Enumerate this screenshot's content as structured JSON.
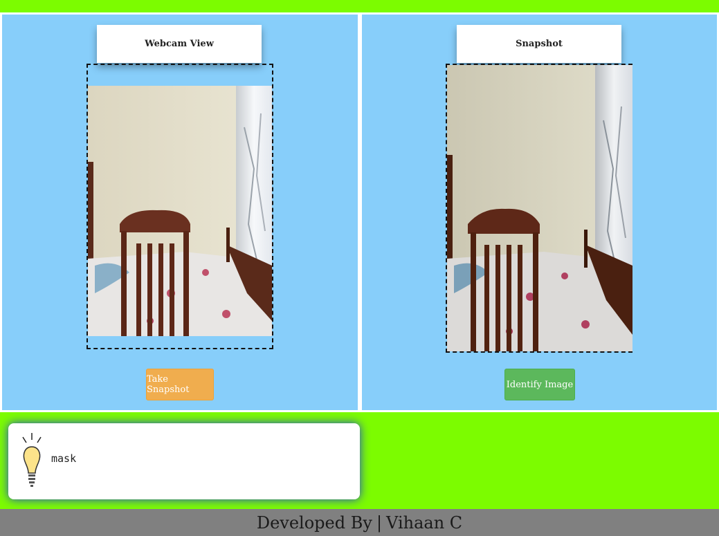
{
  "webcam": {
    "title": "Webcam View",
    "button_label": "Take Snapshot"
  },
  "snapshot": {
    "title": "Snapshot",
    "button_label": "Identify Image"
  },
  "result": {
    "icon": "lightbulb-icon",
    "text": "mask"
  },
  "footer": {
    "prefix": "Developed By",
    "separator": "|",
    "author": "Vihaan C"
  },
  "colors": {
    "page_background": "#7cfc00",
    "panel_background": "#87cefa",
    "take_snapshot_button": "#f0ad4e",
    "identify_button": "#5cb85c",
    "footer_background": "#808080"
  }
}
